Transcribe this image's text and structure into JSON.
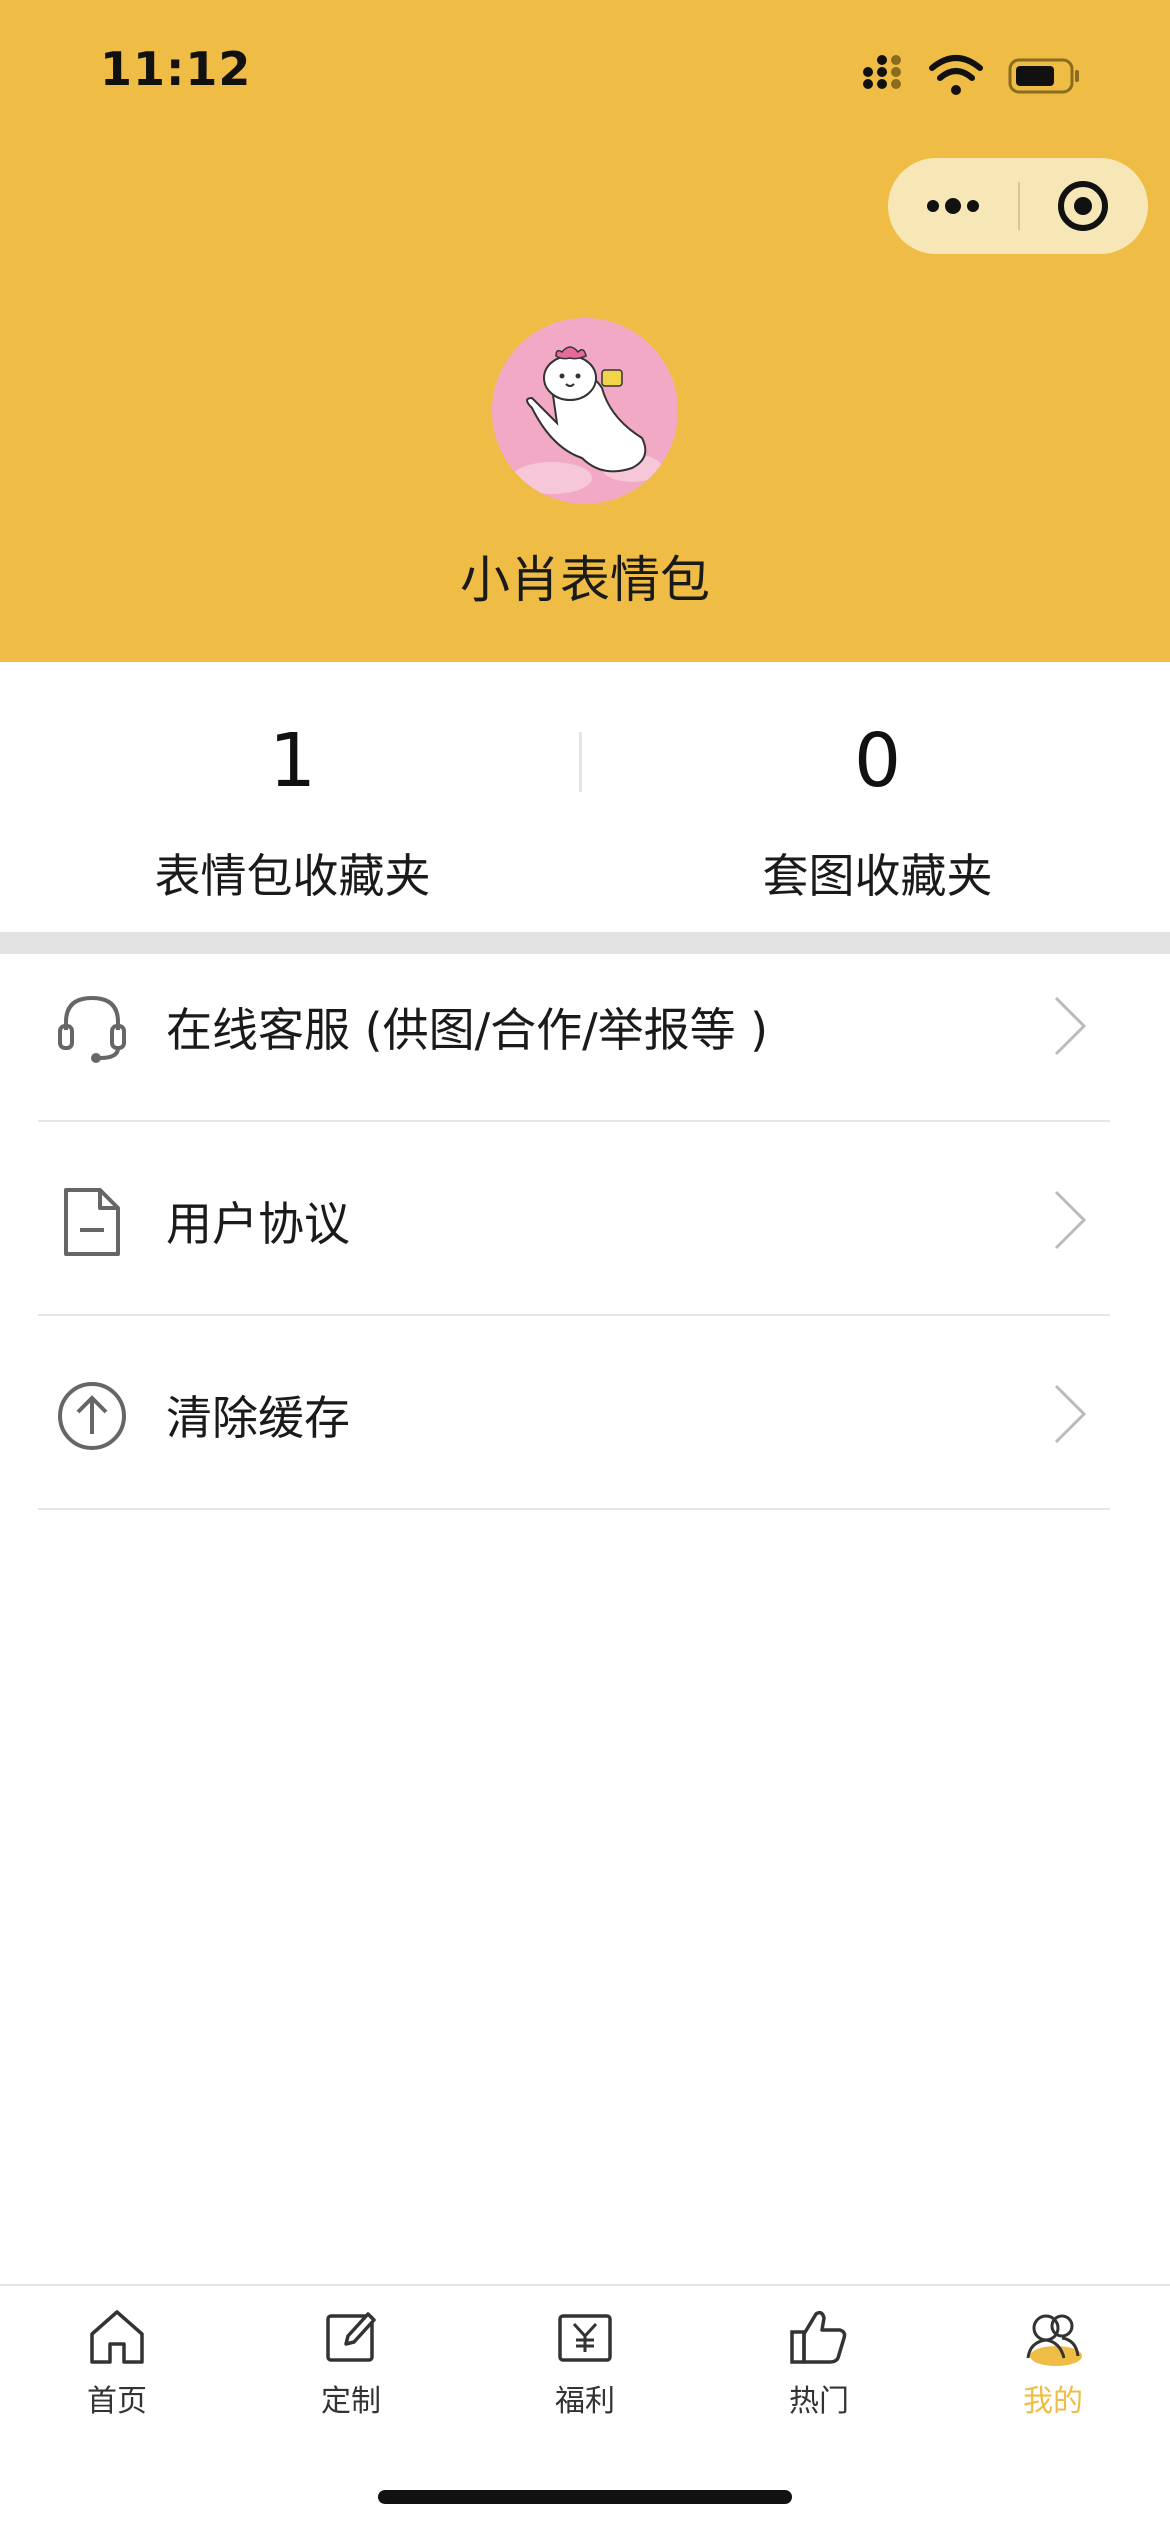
{
  "status_bar": {
    "time": "11:12"
  },
  "capsule": {
    "more_icon": "more-dots-icon",
    "close_icon": "target-circle-icon"
  },
  "profile": {
    "username": "小肖表情包",
    "avatar_icon": "cartoon-bunny-avatar"
  },
  "stats": [
    {
      "value": "1",
      "label": "表情包收藏夹"
    },
    {
      "value": "0",
      "label": "套图收藏夹"
    }
  ],
  "menu": [
    {
      "label": "在线客服 (供图/合作/举报等 )",
      "icon": "headset-icon"
    },
    {
      "label": "用户协议",
      "icon": "document-icon"
    },
    {
      "label": "清除缓存",
      "icon": "upload-circle-icon"
    }
  ],
  "tabbar": {
    "active_color": "#efbd45",
    "items": [
      {
        "label": "首页",
        "icon": "home-icon"
      },
      {
        "label": "定制",
        "icon": "edit-icon"
      },
      {
        "label": "福利",
        "icon": "yen-gift-icon"
      },
      {
        "label": "热门",
        "icon": "thumbs-up-icon"
      },
      {
        "label": "我的",
        "icon": "users-icon",
        "active": true
      }
    ]
  },
  "colors": {
    "header_bg": "#efbd45",
    "divider": "#e6e6e6"
  }
}
